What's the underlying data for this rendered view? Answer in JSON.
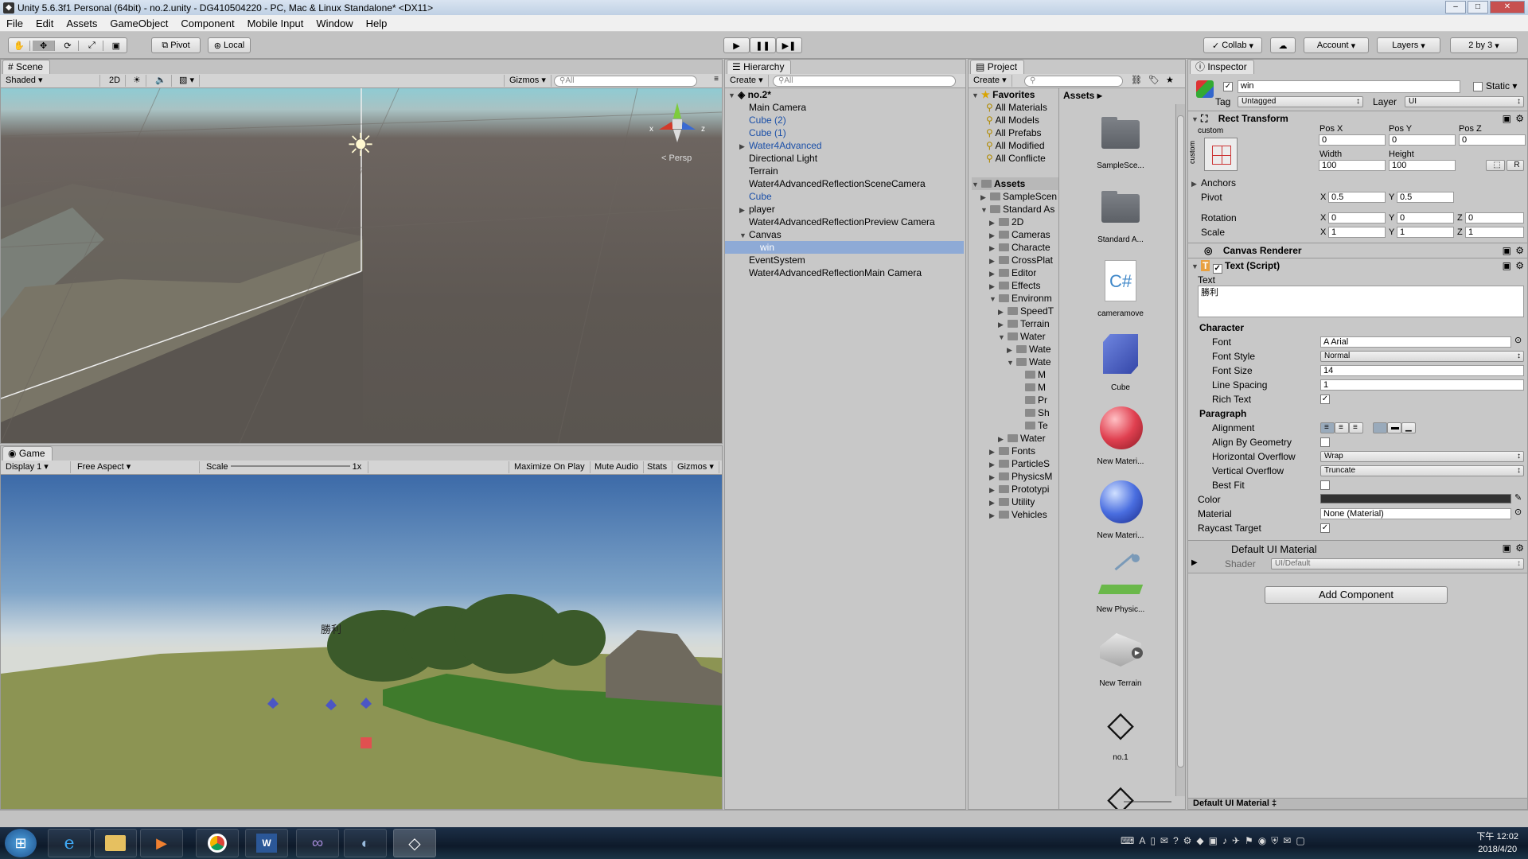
{
  "window": {
    "title": "Unity 5.6.3f1 Personal (64bit) - no.2.unity - DG410504220 - PC, Mac & Linux Standalone* <DX11>",
    "min": "–",
    "max": "□",
    "close": "✕"
  },
  "menu": [
    "File",
    "Edit",
    "Assets",
    "GameObject",
    "Component",
    "Mobile Input",
    "Window",
    "Help"
  ],
  "toolbar": {
    "pivot": "Pivot",
    "local": "Local",
    "collab": "Collab",
    "account": "Account",
    "layers": "Layers",
    "layout": "2 by 3",
    "play": "▶",
    "pause": "❚❚",
    "step": "▶❚"
  },
  "scene": {
    "tab": "Scene",
    "shading": "Shaded",
    "mode2d": "2D",
    "gizmos": "Gizmos",
    "search": "All",
    "persp": "Persp",
    "axis_x": "x",
    "axis_z": "z",
    "axis_y": "y"
  },
  "game": {
    "tab": "Game",
    "display": "Display 1",
    "aspect": "Free Aspect",
    "scale_label": "Scale",
    "scale_value": "1x",
    "maximize": "Maximize On Play",
    "mute": "Mute Audio",
    "stats": "Stats",
    "gizmos": "Gizmos",
    "overlay_text": "勝利"
  },
  "hierarchy": {
    "tab": "Hierarchy",
    "create": "Create",
    "search": "All",
    "scene_name": "no.2*",
    "items": [
      {
        "label": "Main Camera",
        "blue": false,
        "arrow": "",
        "indent": 1
      },
      {
        "label": "Cube (2)",
        "blue": true,
        "arrow": "",
        "indent": 1
      },
      {
        "label": "Cube (1)",
        "blue": true,
        "arrow": "",
        "indent": 1
      },
      {
        "label": "Water4Advanced",
        "blue": true,
        "arrow": "▶",
        "indent": 1
      },
      {
        "label": "Directional Light",
        "blue": false,
        "arrow": "",
        "indent": 1
      },
      {
        "label": "Terrain",
        "blue": false,
        "arrow": "",
        "indent": 1
      },
      {
        "label": "Water4AdvancedReflectionSceneCamera",
        "blue": false,
        "arrow": "",
        "indent": 1
      },
      {
        "label": "Cube",
        "blue": true,
        "arrow": "",
        "indent": 1
      },
      {
        "label": "player",
        "blue": false,
        "arrow": "▶",
        "indent": 1
      },
      {
        "label": "Water4AdvancedReflectionPreview Camera",
        "blue": false,
        "arrow": "",
        "indent": 1
      },
      {
        "label": "Canvas",
        "blue": false,
        "arrow": "▼",
        "indent": 1
      },
      {
        "label": "win",
        "blue": false,
        "arrow": "",
        "indent": 2,
        "selected": true
      },
      {
        "label": "EventSystem",
        "blue": false,
        "arrow": "",
        "indent": 1
      },
      {
        "label": "Water4AdvancedReflectionMain Camera",
        "blue": false,
        "arrow": "",
        "indent": 1
      }
    ]
  },
  "project": {
    "tab": "Project",
    "create": "Create",
    "favorites": "Favorites",
    "fav_items": [
      "All Materials",
      "All Models",
      "All Prefabs",
      "All Modified",
      "All Conflicte"
    ],
    "assets_root": "Assets",
    "breadcrumb": "Assets",
    "tree": [
      {
        "label": "SampleScen",
        "indent": 1,
        "arrow": "▶"
      },
      {
        "label": "Standard As",
        "indent": 1,
        "arrow": "▼"
      },
      {
        "label": "2D",
        "indent": 2,
        "arrow": "▶"
      },
      {
        "label": "Cameras",
        "indent": 2,
        "arrow": "▶"
      },
      {
        "label": "Characte",
        "indent": 2,
        "arrow": "▶"
      },
      {
        "label": "CrossPlat",
        "indent": 2,
        "arrow": "▶"
      },
      {
        "label": "Editor",
        "indent": 2,
        "arrow": "▶"
      },
      {
        "label": "Effects",
        "indent": 2,
        "arrow": "▶"
      },
      {
        "label": "Environm",
        "indent": 2,
        "arrow": "▼"
      },
      {
        "label": "SpeedT",
        "indent": 3,
        "arrow": "▶"
      },
      {
        "label": "Terrain",
        "indent": 3,
        "arrow": "▶"
      },
      {
        "label": "Water",
        "indent": 3,
        "arrow": "▼"
      },
      {
        "label": "Wate",
        "indent": 4,
        "arrow": "▶"
      },
      {
        "label": "Wate",
        "indent": 4,
        "arrow": "▼"
      },
      {
        "label": "M",
        "indent": 5,
        "arrow": ""
      },
      {
        "label": "M",
        "indent": 5,
        "arrow": ""
      },
      {
        "label": "Pr",
        "indent": 5,
        "arrow": ""
      },
      {
        "label": "Sh",
        "indent": 5,
        "arrow": ""
      },
      {
        "label": "Te",
        "indent": 5,
        "arrow": ""
      },
      {
        "label": "Water",
        "indent": 3,
        "arrow": "▶"
      },
      {
        "label": "Fonts",
        "indent": 2,
        "arrow": "▶"
      },
      {
        "label": "ParticleS",
        "indent": 2,
        "arrow": "▶"
      },
      {
        "label": "PhysicsM",
        "indent": 2,
        "arrow": "▶"
      },
      {
        "label": "Prototypi",
        "indent": 2,
        "arrow": "▶"
      },
      {
        "label": "Utility",
        "indent": 2,
        "arrow": "▶"
      },
      {
        "label": "Vehicles",
        "indent": 2,
        "arrow": "▶"
      }
    ],
    "assets": [
      {
        "label": "SampleSce...",
        "kind": "folder"
      },
      {
        "label": "Standard A...",
        "kind": "folder"
      },
      {
        "label": "cameramove",
        "kind": "script"
      },
      {
        "label": "Cube",
        "kind": "cube"
      },
      {
        "label": "New Materi...",
        "kind": "red-sphere"
      },
      {
        "label": "New Materi...",
        "kind": "blue-sphere"
      },
      {
        "label": "New Physic...",
        "kind": "physic"
      },
      {
        "label": "New Terrain",
        "kind": "terrain"
      },
      {
        "label": "no.1",
        "kind": "unity"
      },
      {
        "label": "",
        "kind": "unity"
      }
    ]
  },
  "inspector": {
    "tab": "Inspector",
    "object_name": "win",
    "static_label": "Static",
    "tag_label": "Tag",
    "tag_value": "Untagged",
    "layer_label": "Layer",
    "layer_value": "UI",
    "rect": {
      "title": "Rect Transform",
      "custom": "custom",
      "posx_l": "Pos X",
      "posy_l": "Pos Y",
      "posz_l": "Pos Z",
      "posx": "0",
      "posy": "0",
      "posz": "0",
      "width_l": "Width",
      "height_l": "Height",
      "width": "100",
      "height": "100",
      "r_btn": "R",
      "anchors": "Anchors",
      "pivot": "Pivot",
      "pivot_x": "0.5",
      "pivot_y": "0.5",
      "rotation": "Rotation",
      "rot_x": "0",
      "rot_y": "0",
      "rot_z": "0",
      "scale": "Scale",
      "sc_x": "1",
      "sc_y": "1",
      "sc_z": "1",
      "x": "X",
      "y": "Y",
      "z": "Z"
    },
    "canvas_renderer": "Canvas Renderer",
    "text_script": {
      "title": "Text (Script)",
      "text_label": "Text",
      "text_value": "勝利",
      "character": "Character",
      "font_l": "Font",
      "font_v": "Arial",
      "style_l": "Font Style",
      "style_v": "Normal",
      "size_l": "Font Size",
      "size_v": "14",
      "spacing_l": "Line Spacing",
      "spacing_v": "1",
      "rich_l": "Rich Text",
      "paragraph": "Paragraph",
      "align_l": "Alignment",
      "geo_l": "Align By Geometry",
      "hover_l": "Horizontal Overflow",
      "hover_v": "Wrap",
      "vover_l": "Vertical Overflow",
      "vover_v": "Truncate",
      "best_l": "Best Fit",
      "color_l": "Color",
      "material_l": "Material",
      "material_v": "None (Material)",
      "raycast_l": "Raycast Target"
    },
    "default_material": "Default UI Material",
    "shader_l": "Shader",
    "shader_v": "UI/Default",
    "add_component": "Add Component",
    "footer": "Default UI Material ‡"
  },
  "tray": {
    "time": "下午 12:02",
    "date": "2018/4/20"
  },
  "colors": {
    "accent": "#3d6fb4",
    "hierarchy_blue": "#1a4fa8",
    "selected": "#8eaad6",
    "text_color_swatch": "#323232"
  }
}
